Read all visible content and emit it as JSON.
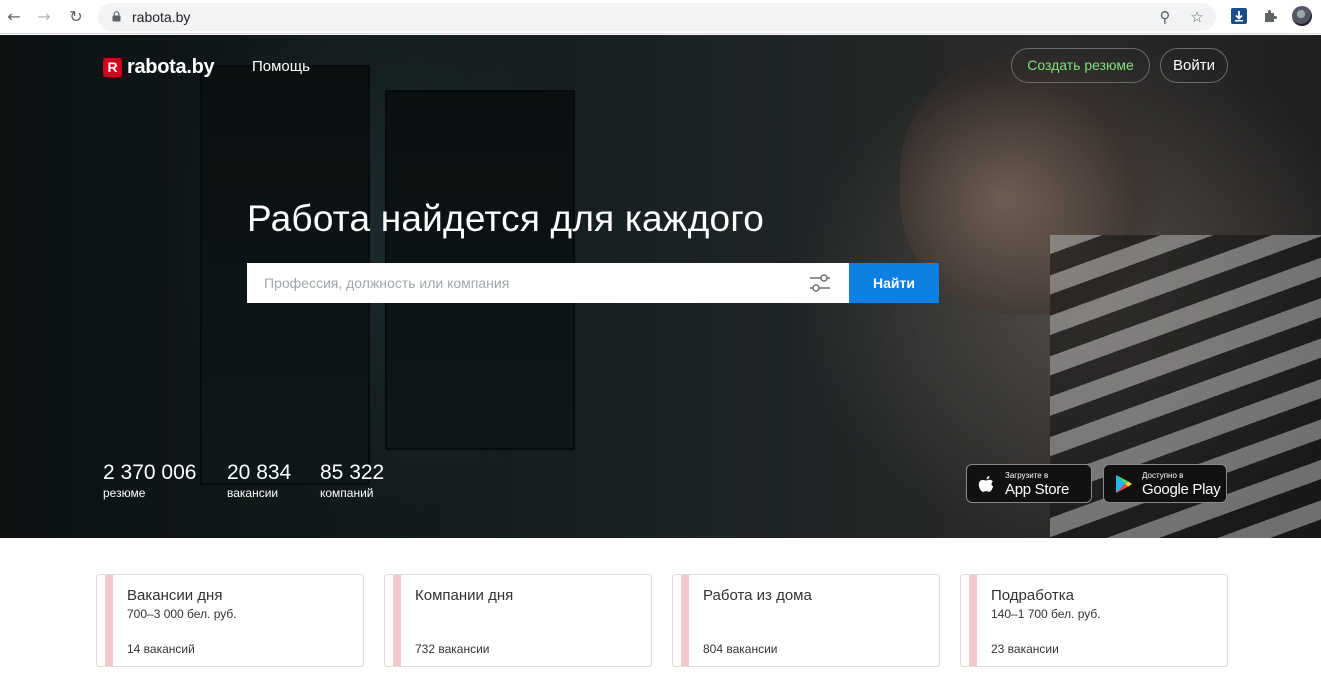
{
  "browser": {
    "url": "rabota.by",
    "back_icon": "←",
    "forward_icon": "→",
    "reload_icon": "↻",
    "zoom_icon": "⚲",
    "star_icon": "☆"
  },
  "header": {
    "logo_badge": "R",
    "logo_text": "rabota.by",
    "help_label": "Помощь",
    "create_resume_label": "Создать резюме",
    "login_label": "Войти"
  },
  "hero": {
    "headline": "Работа найдется для каждого",
    "search_placeholder": "Профессия, должность или компания",
    "search_button_label": "Найти"
  },
  "stats": [
    {
      "value": "2 370 006",
      "label": "резюме"
    },
    {
      "value": "20 834",
      "label": "вакансии"
    },
    {
      "value": "85 322",
      "label": "компаний"
    }
  ],
  "stores": {
    "appstore_small": "Загрузите в",
    "appstore_big": "App Store",
    "googleplay_small": "Доступно в",
    "googleplay_big": "Google Play"
  },
  "cards": [
    {
      "title": "Вакансии дня",
      "subtitle": "700–3 000 бел. руб.",
      "count": "14 вакансий"
    },
    {
      "title": "Компании дня",
      "subtitle": "",
      "count": "732 вакансии"
    },
    {
      "title": "Работа из дома",
      "subtitle": "",
      "count": "804 вакансии"
    },
    {
      "title": "Подработка",
      "subtitle": "140–1 700 бел. руб.",
      "count": "23 вакансии"
    }
  ],
  "colors": {
    "brand_red": "#d6001c",
    "search_blue": "#0e7fe3",
    "resume_green": "#7fe07f"
  }
}
